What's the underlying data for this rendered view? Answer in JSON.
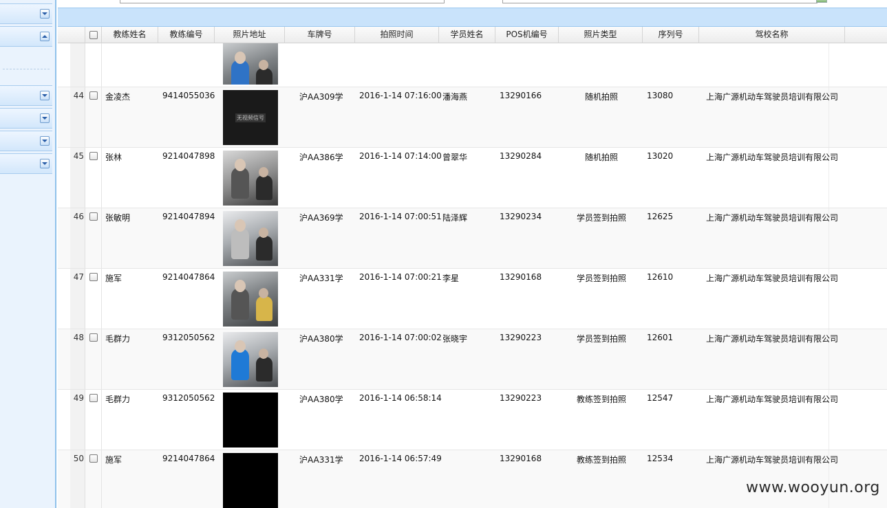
{
  "grid": {
    "columns": [
      {
        "label": ""
      },
      {
        "label": ""
      },
      {
        "label": "教练姓名"
      },
      {
        "label": "教练编号"
      },
      {
        "label": "照片地址"
      },
      {
        "label": "车牌号"
      },
      {
        "label": "拍照时间"
      },
      {
        "label": "学员姓名"
      },
      {
        "label": "POS机编号"
      },
      {
        "label": "照片类型"
      },
      {
        "label": "序列号"
      },
      {
        "label": "驾校名称"
      }
    ],
    "rows": [
      {
        "num": "",
        "coach": "",
        "code": "",
        "photo": "cam-blue",
        "plate": "",
        "time": "",
        "student": "",
        "pos": "",
        "type": "",
        "serial": "",
        "school": ""
      },
      {
        "num": "44",
        "coach": "金凌杰",
        "code": "9414055036",
        "photo": "no-signal",
        "plate": "沪AA309学",
        "time": "2016-1-14 07:16:00",
        "student": "潘海燕",
        "pos": "13290166",
        "type": "随机拍照",
        "serial": "13080",
        "school": "上海广源机动车驾驶员培训有限公司"
      },
      {
        "num": "45",
        "coach": "张林",
        "code": "9214047898",
        "photo": "cam-gray",
        "plate": "沪AA386学",
        "time": "2016-1-14 07:14:00",
        "student": "曾翠华",
        "pos": "13290284",
        "type": "随机拍照",
        "serial": "13020",
        "school": "上海广源机动车驾驶员培训有限公司"
      },
      {
        "num": "46",
        "coach": "张敏明",
        "code": "9214047894",
        "photo": "cam-bright",
        "plate": "沪AA369学",
        "time": "2016-1-14 07:00:51",
        "student": "陆泽辉",
        "pos": "13290234",
        "type": "学员签到拍照",
        "serial": "12625",
        "school": "上海广源机动车驾驶员培训有限公司"
      },
      {
        "num": "47",
        "coach": "施军",
        "code": "9214047864",
        "photo": "cam-yellow",
        "plate": "沪AA331学",
        "time": "2016-1-14 07:00:21",
        "student": "李星",
        "pos": "13290168",
        "type": "学员签到拍照",
        "serial": "12610",
        "school": "上海广源机动车驾驶员培训有限公司"
      },
      {
        "num": "48",
        "coach": "毛群力",
        "code": "9312050562",
        "photo": "cam-blue2",
        "plate": "沪AA380学",
        "time": "2016-1-14 07:00:02",
        "student": "张晓宇",
        "pos": "13290223",
        "type": "学员签到拍照",
        "serial": "12601",
        "school": "上海广源机动车驾驶员培训有限公司"
      },
      {
        "num": "49",
        "coach": "毛群力",
        "code": "9312050562",
        "photo": "black",
        "plate": "沪AA380学",
        "time": "2016-1-14 06:58:14",
        "student": "",
        "pos": "13290223",
        "type": "教练签到拍照",
        "serial": "12547",
        "school": "上海广源机动车驾驶员培训有限公司"
      },
      {
        "num": "50",
        "coach": "施军",
        "code": "9214047864",
        "photo": "black",
        "plate": "沪AA331学",
        "time": "2016-1-14 06:57:49",
        "student": "",
        "pos": "13290168",
        "type": "教练签到拍照",
        "serial": "12534",
        "school": "上海广源机动车驾驶员培训有限公司"
      }
    ]
  },
  "photo_labels": {
    "no_signal": "无视频信号"
  },
  "icons": {
    "collapse": "chevron-up-icon",
    "expand": "chevron-down-icon",
    "checkbox": "checkbox-icon"
  },
  "watermark": "www.wooyun.org",
  "colors": {
    "header_bar": "#c9e3fb",
    "sidebar": "#eaf3fd",
    "sidebar_border": "#8fc1ea"
  }
}
